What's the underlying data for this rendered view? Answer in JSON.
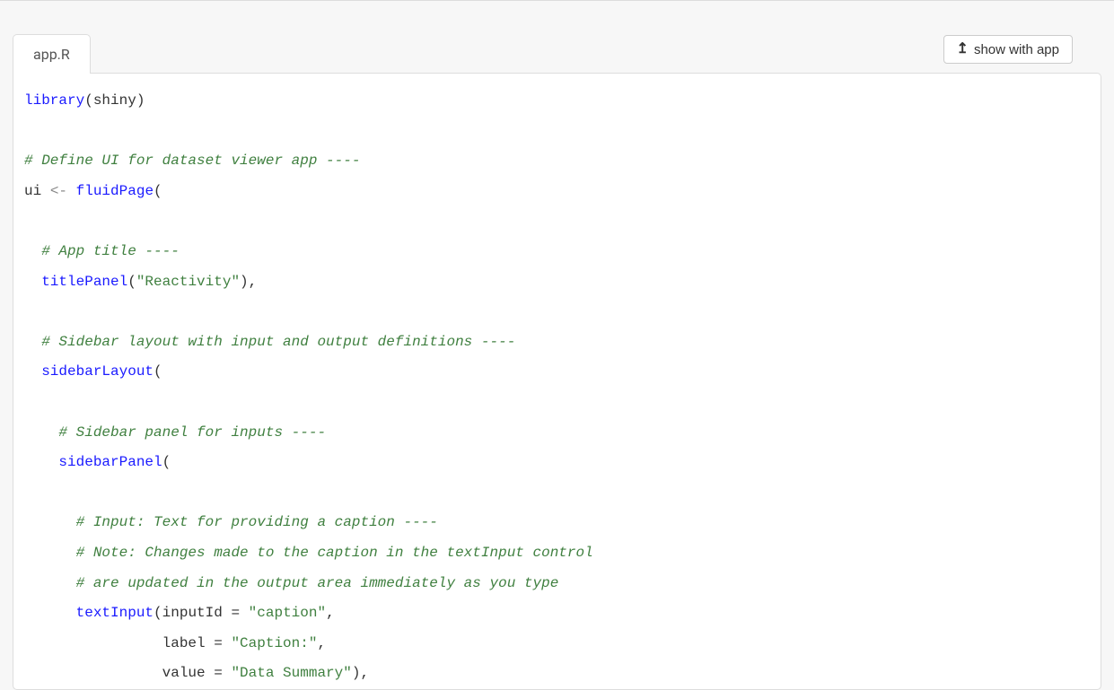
{
  "button": {
    "show_with_app": "show with app"
  },
  "tab": {
    "label": "app.R"
  },
  "code": {
    "tokens": [
      {
        "t": "library",
        "c": "func"
      },
      {
        "t": "(shiny)",
        "c": "punct"
      },
      {
        "t": "\n",
        "c": "nl"
      },
      {
        "t": "\n",
        "c": "nl"
      },
      {
        "t": "# Define UI for dataset viewer app ----",
        "c": "comment"
      },
      {
        "t": "\n",
        "c": "nl"
      },
      {
        "t": "ui ",
        "c": "name"
      },
      {
        "t": "<-",
        "c": "op"
      },
      {
        "t": " ",
        "c": "name"
      },
      {
        "t": "fluidPage",
        "c": "func"
      },
      {
        "t": "(",
        "c": "punct"
      },
      {
        "t": "\n",
        "c": "nl"
      },
      {
        "t": "\n",
        "c": "nl"
      },
      {
        "t": "  ",
        "c": "name"
      },
      {
        "t": "# App title ----",
        "c": "comment"
      },
      {
        "t": "\n",
        "c": "nl"
      },
      {
        "t": "  ",
        "c": "name"
      },
      {
        "t": "titlePanel",
        "c": "func"
      },
      {
        "t": "(",
        "c": "punct"
      },
      {
        "t": "\"Reactivity\"",
        "c": "string"
      },
      {
        "t": "),",
        "c": "punct"
      },
      {
        "t": "\n",
        "c": "nl"
      },
      {
        "t": "\n",
        "c": "nl"
      },
      {
        "t": "  ",
        "c": "name"
      },
      {
        "t": "# Sidebar layout with input and output definitions ----",
        "c": "comment"
      },
      {
        "t": "\n",
        "c": "nl"
      },
      {
        "t": "  ",
        "c": "name"
      },
      {
        "t": "sidebarLayout",
        "c": "func"
      },
      {
        "t": "(",
        "c": "punct"
      },
      {
        "t": "\n",
        "c": "nl"
      },
      {
        "t": "\n",
        "c": "nl"
      },
      {
        "t": "    ",
        "c": "name"
      },
      {
        "t": "# Sidebar panel for inputs ----",
        "c": "comment"
      },
      {
        "t": "\n",
        "c": "nl"
      },
      {
        "t": "    ",
        "c": "name"
      },
      {
        "t": "sidebarPanel",
        "c": "func"
      },
      {
        "t": "(",
        "c": "punct"
      },
      {
        "t": "\n",
        "c": "nl"
      },
      {
        "t": "\n",
        "c": "nl"
      },
      {
        "t": "      ",
        "c": "name"
      },
      {
        "t": "# Input: Text for providing a caption ----",
        "c": "comment"
      },
      {
        "t": "\n",
        "c": "nl"
      },
      {
        "t": "      ",
        "c": "name"
      },
      {
        "t": "# Note: Changes made to the caption in the textInput control",
        "c": "comment"
      },
      {
        "t": "\n",
        "c": "nl"
      },
      {
        "t": "      ",
        "c": "name"
      },
      {
        "t": "# are updated in the output area immediately as you type",
        "c": "comment"
      },
      {
        "t": "\n",
        "c": "nl"
      },
      {
        "t": "      ",
        "c": "name"
      },
      {
        "t": "textInput",
        "c": "func"
      },
      {
        "t": "(inputId = ",
        "c": "punct"
      },
      {
        "t": "\"caption\"",
        "c": "string"
      },
      {
        "t": ",",
        "c": "punct"
      },
      {
        "t": "\n",
        "c": "nl"
      },
      {
        "t": "                label = ",
        "c": "punct"
      },
      {
        "t": "\"Caption:\"",
        "c": "string"
      },
      {
        "t": ",",
        "c": "punct"
      },
      {
        "t": "\n",
        "c": "nl"
      },
      {
        "t": "                value = ",
        "c": "punct"
      },
      {
        "t": "\"Data Summary\"",
        "c": "string"
      },
      {
        "t": "),",
        "c": "punct"
      },
      {
        "t": "\n",
        "c": "nl"
      }
    ]
  }
}
